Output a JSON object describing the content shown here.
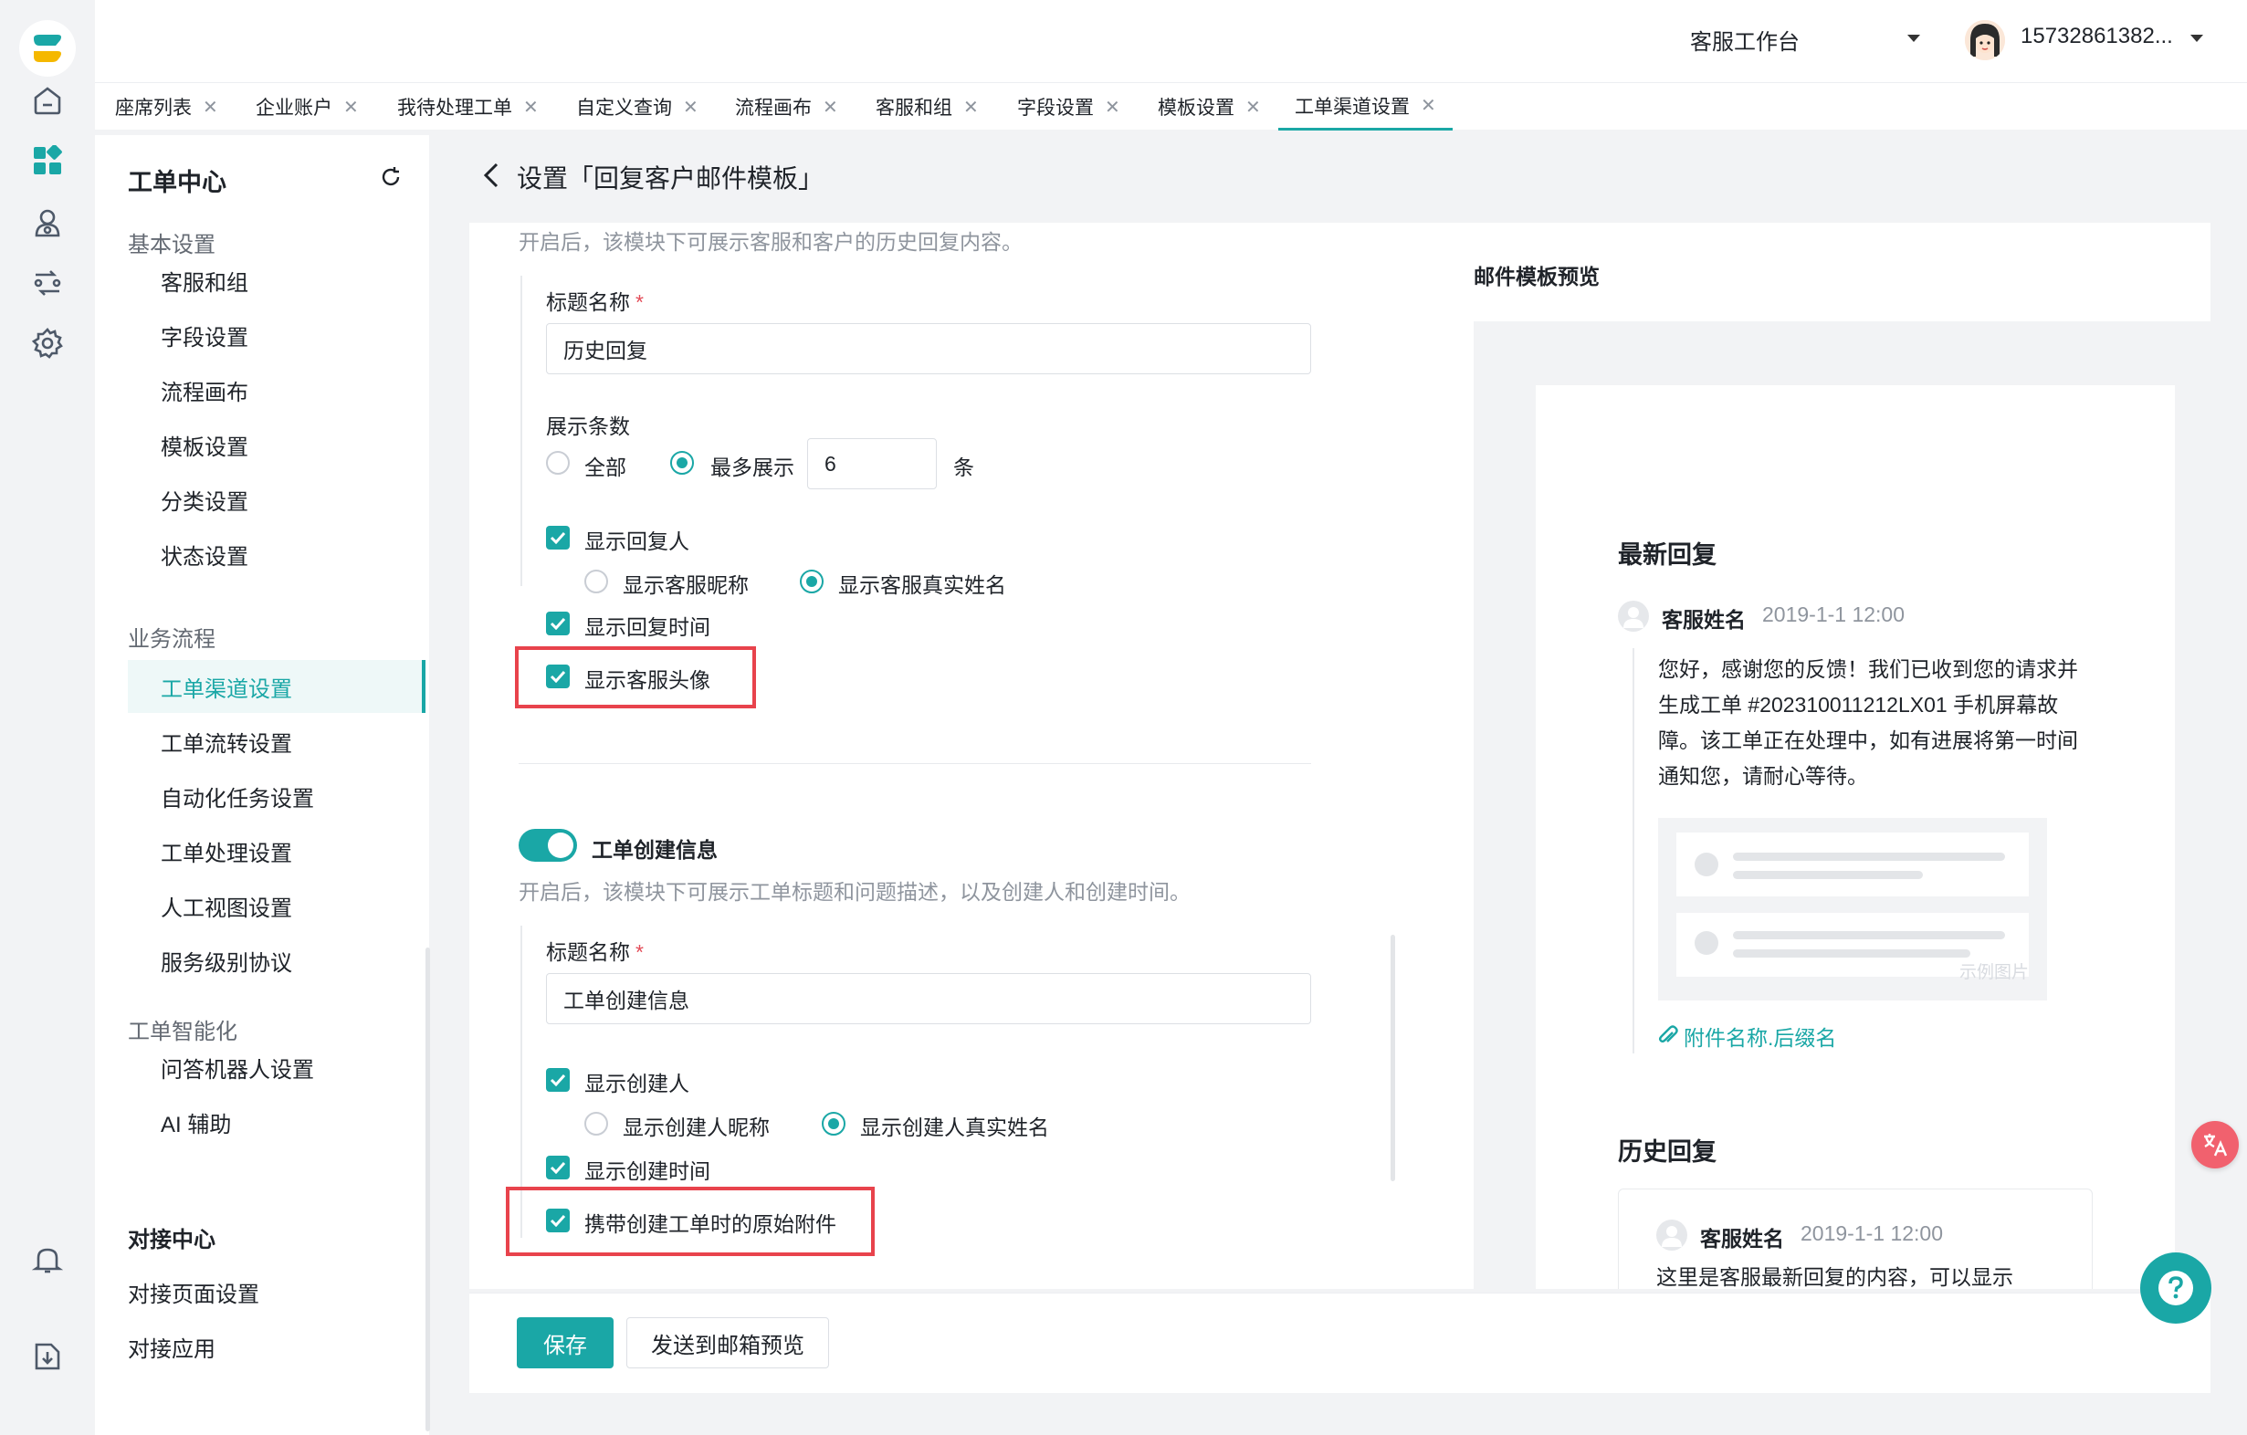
{
  "topbar": {
    "workspace": "客服工作台",
    "user": "15732861382..."
  },
  "tabs": [
    {
      "label": "座席列表"
    },
    {
      "label": "企业账户"
    },
    {
      "label": "我待处理工单"
    },
    {
      "label": "自定义查询"
    },
    {
      "label": "流程画布"
    },
    {
      "label": "客服和组"
    },
    {
      "label": "字段设置"
    },
    {
      "label": "模板设置"
    },
    {
      "label": "工单渠道设置"
    }
  ],
  "sidebar": {
    "title": "工单中心",
    "group_basic": "基本设置",
    "basic_items": [
      "客服和组",
      "字段设置",
      "流程画布",
      "模板设置",
      "分类设置",
      "状态设置"
    ],
    "group_flow": "业务流程",
    "flow_items": [
      "工单渠道设置",
      "工单流转设置",
      "自动化任务设置",
      "工单处理设置",
      "人工视图设置",
      "服务级别协议"
    ],
    "group_ai": "工单智能化",
    "ai_items": [
      "问答机器人设置",
      "AI 辅助"
    ],
    "section2_title": "对接中心",
    "section2_items": [
      "对接页面设置",
      "对接应用"
    ]
  },
  "page": {
    "title": "设置「回复客户邮件模板」"
  },
  "history_section": {
    "desc": "开启后，该模块下可展示客服和客户的历史回复内容。",
    "title_label": "标题名称",
    "title_required": "*",
    "title_value": "历史回复",
    "count_label": "展示条数",
    "opt_all": "全部",
    "opt_max": "最多展示",
    "max_value": "6",
    "unit": "条",
    "show_replier": "显示回复人",
    "show_nick": "显示客服昵称",
    "show_realname": "显示客服真实姓名",
    "show_reply_time": "显示回复时间",
    "show_avatar": "显示客服头像"
  },
  "create_section": {
    "name": "工单创建信息",
    "desc": "开启后，该模块下可展示工单标题和问题描述，以及创建人和创建时间。",
    "title_label": "标题名称",
    "title_required": "*",
    "title_value": "工单创建信息",
    "show_creator": "显示创建人",
    "show_creator_nick": "显示创建人昵称",
    "show_creator_realname": "显示创建人真实姓名",
    "show_create_time": "显示创建时间",
    "carry_attachments": "携带创建工单时的原始附件"
  },
  "preview": {
    "title": "邮件模板预览",
    "latest_heading": "最新回复",
    "agent_name": "客服姓名",
    "time": "2019-1-1 12:00",
    "latest_body": "您好，感谢您的反馈！我们已收到您的请求并生成工单 #202310011212LX01 手机屏幕故障。该工单正在处理中，如有进展将第一时间通知您，请耐心等待。",
    "sample_image": "示例图片",
    "attachment": "附件名称.后缀名",
    "history_heading": "历史回复",
    "history_name": "客服姓名",
    "history_time": "2019-1-1 12:00",
    "history_body": "这里是客服最新回复的内容，可以显示"
  },
  "footer": {
    "save": "保存",
    "send_preview": "发送到邮箱预览"
  },
  "colors": {
    "accent": "#1aa7a6",
    "highlight": "#e8434c"
  }
}
